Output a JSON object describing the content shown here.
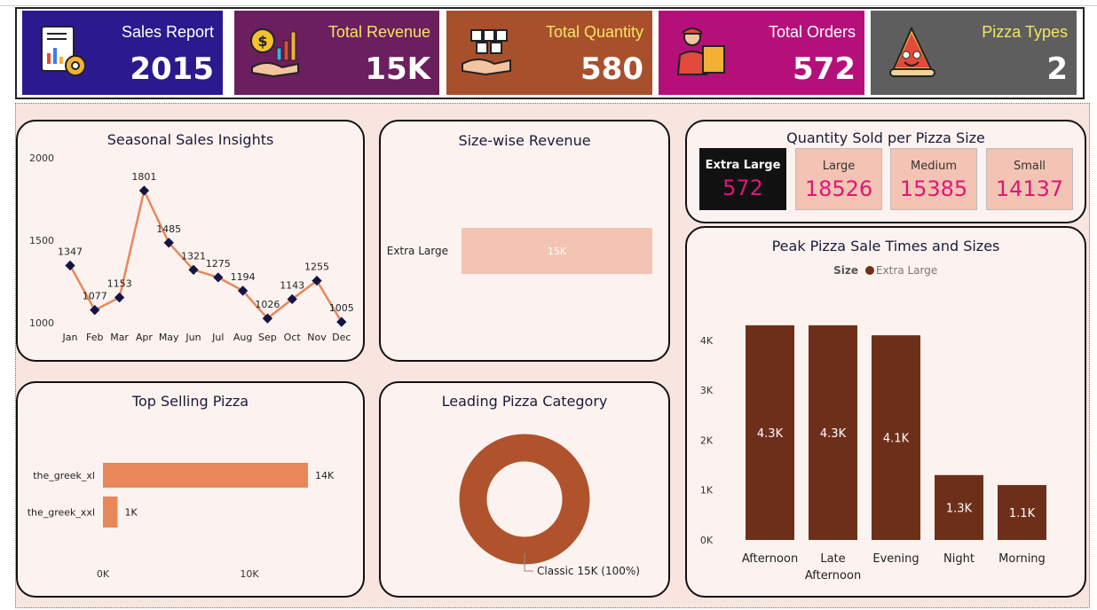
{
  "kpis": [
    {
      "title": "Sales Report",
      "value": "2015",
      "bg": "#2a1a8e",
      "title_color": "#ffffff",
      "icon": "report-icon"
    },
    {
      "title": "Total Revenue",
      "value": "15K",
      "bg": "#6b1f5e",
      "title_color": "#f5e663",
      "icon": "revenue-icon"
    },
    {
      "title": "Total Quantity",
      "value": "580",
      "bg": "#a8502c",
      "title_color": "#f5e663",
      "icon": "quantity-icon"
    },
    {
      "title": "Total Orders",
      "value": "572",
      "bg": "#b5107a",
      "title_color": "#ffffff",
      "icon": "delivery-icon"
    },
    {
      "title": "Pizza Types",
      "value": "2",
      "bg": "#5e5e5e",
      "title_color": "#f5e663",
      "icon": "pizza-icon"
    }
  ],
  "cards": {
    "seasonal": "Seasonal Sales Insights",
    "size_revenue": "Size-wise Revenue",
    "quantity_size": "Quantity Sold per Pizza Size",
    "top_pizza": "Top Selling Pizza",
    "leading_category": "Leading Pizza Category",
    "peak_times": "Peak Pizza Sale Times and Sizes"
  },
  "quantity_boxes": [
    {
      "label": "Extra Large",
      "value": "572"
    },
    {
      "label": "Large",
      "value": "18526"
    },
    {
      "label": "Medium",
      "value": "15385"
    },
    {
      "label": "Small",
      "value": "14137"
    }
  ],
  "chart_data": [
    {
      "id": "seasonal",
      "type": "line",
      "x": [
        "Jan",
        "Feb",
        "Mar",
        "Apr",
        "May",
        "Jun",
        "Jul",
        "Aug",
        "Sep",
        "Oct",
        "Nov",
        "Dec"
      ],
      "values": [
        1347,
        1077,
        1153,
        1801,
        1485,
        1321,
        1275,
        1194,
        1026,
        1143,
        1255,
        1005
      ],
      "data_labels": [
        "1347",
        "1077",
        "1153",
        "1801",
        "1485",
        "1321",
        "1275",
        "1194",
        "1026",
        "1143",
        "1255",
        "1005"
      ],
      "yticks": [
        "1000",
        "1500",
        "2000"
      ],
      "ylim": [
        1000,
        2000
      ],
      "color": "#e8875a",
      "marker_color": "#141446"
    },
    {
      "id": "size_revenue",
      "type": "bar",
      "categories": [
        "Extra Large"
      ],
      "values": [
        15000
      ],
      "data_labels": [
        "15K"
      ],
      "color": "#f3c4b3"
    },
    {
      "id": "top_pizza",
      "type": "bar",
      "categories": [
        "the_greek_xl",
        "the_greek_xxl"
      ],
      "values": [
        14000,
        1000
      ],
      "data_labels": [
        "14K",
        "1K"
      ],
      "xticks": [
        "0K",
        "10K"
      ],
      "xlim": [
        0,
        20000
      ],
      "color": "#e8875a"
    },
    {
      "id": "leading_category",
      "type": "pie",
      "categories": [
        "Classic"
      ],
      "values": [
        15000
      ],
      "data_labels": [
        "Classic 15K (100%)"
      ],
      "color": "#b0532c"
    },
    {
      "id": "peak_times",
      "type": "bar",
      "legend_title": "Size",
      "legend": "Extra Large",
      "categories": [
        "Afternoon",
        "Late Afternoon",
        "Evening",
        "Night",
        "Morning"
      ],
      "category_lines": [
        [
          "Afternoon"
        ],
        [
          "Late",
          "Afternoon"
        ],
        [
          "Evening"
        ],
        [
          "Night"
        ],
        [
          "Morning"
        ]
      ],
      "values": [
        4300,
        4300,
        4100,
        1300,
        1100
      ],
      "data_labels": [
        "4.3K",
        "4.3K",
        "4.1K",
        "1.3K",
        "1.1K"
      ],
      "yticks": [
        "0K",
        "1K",
        "2K",
        "3K",
        "4K"
      ],
      "ylim": [
        0,
        4600
      ],
      "color": "#6e2f1a"
    }
  ]
}
